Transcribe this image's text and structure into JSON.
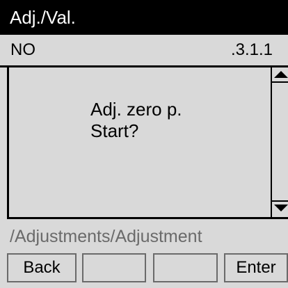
{
  "header": {
    "title": "Adj./Val."
  },
  "info": {
    "left": "NO",
    "right": ".3.1.1"
  },
  "message": {
    "line1": "Adj. zero p.",
    "line2": "Start?"
  },
  "path": "/Adjustments/Adjustment",
  "softkeys": [
    {
      "label": "Back"
    },
    {
      "label": ""
    },
    {
      "label": ""
    },
    {
      "label": "Enter"
    }
  ]
}
